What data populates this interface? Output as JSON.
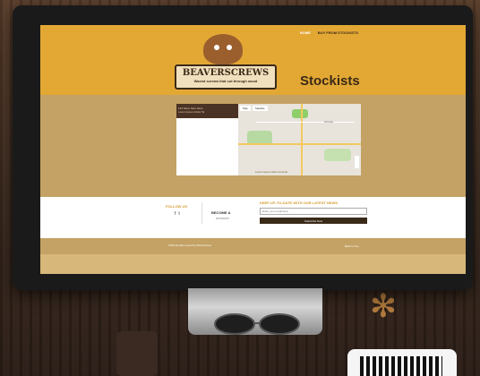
{
  "nav": {
    "home": "HOME",
    "buy": "BUY FROM STOCKISTS"
  },
  "logo": {
    "title": "BEAVERSCREWS",
    "tagline": "Waxed screws that cut through wood"
  },
  "page": {
    "title": "Stockists"
  },
  "store_list": {
    "name": "123 Store Nice Store",
    "address": "Lorem Ipsum Dolor St"
  },
  "map": {
    "tabs": [
      "Map",
      "Satellite"
    ],
    "city": "Toronto",
    "caption": "Lorem ipsum dolor sit amet"
  },
  "footer": {
    "follow": "FOLLOW US",
    "social": [
      "f",
      "t"
    ],
    "become": "BECOME A",
    "stockist": "STOCKIST",
    "news_title": "KEEP UP-TO-DATE WITH OUR LATEST NEWS",
    "email_placeholder": "Enter your email here",
    "subscribe": "Subscribe Now",
    "copyright": "©2014 All rights reserved by BeaverScrews",
    "back_top": "Back to Top"
  },
  "colors": {
    "header": "#e3a834",
    "tan": "#c4a265",
    "dark": "#3a2a18",
    "accent": "#d59c2d"
  },
  "icons": [
    "apple-logo-icon",
    "facebook-icon",
    "twitter-icon",
    "zoom-control-icon"
  ]
}
